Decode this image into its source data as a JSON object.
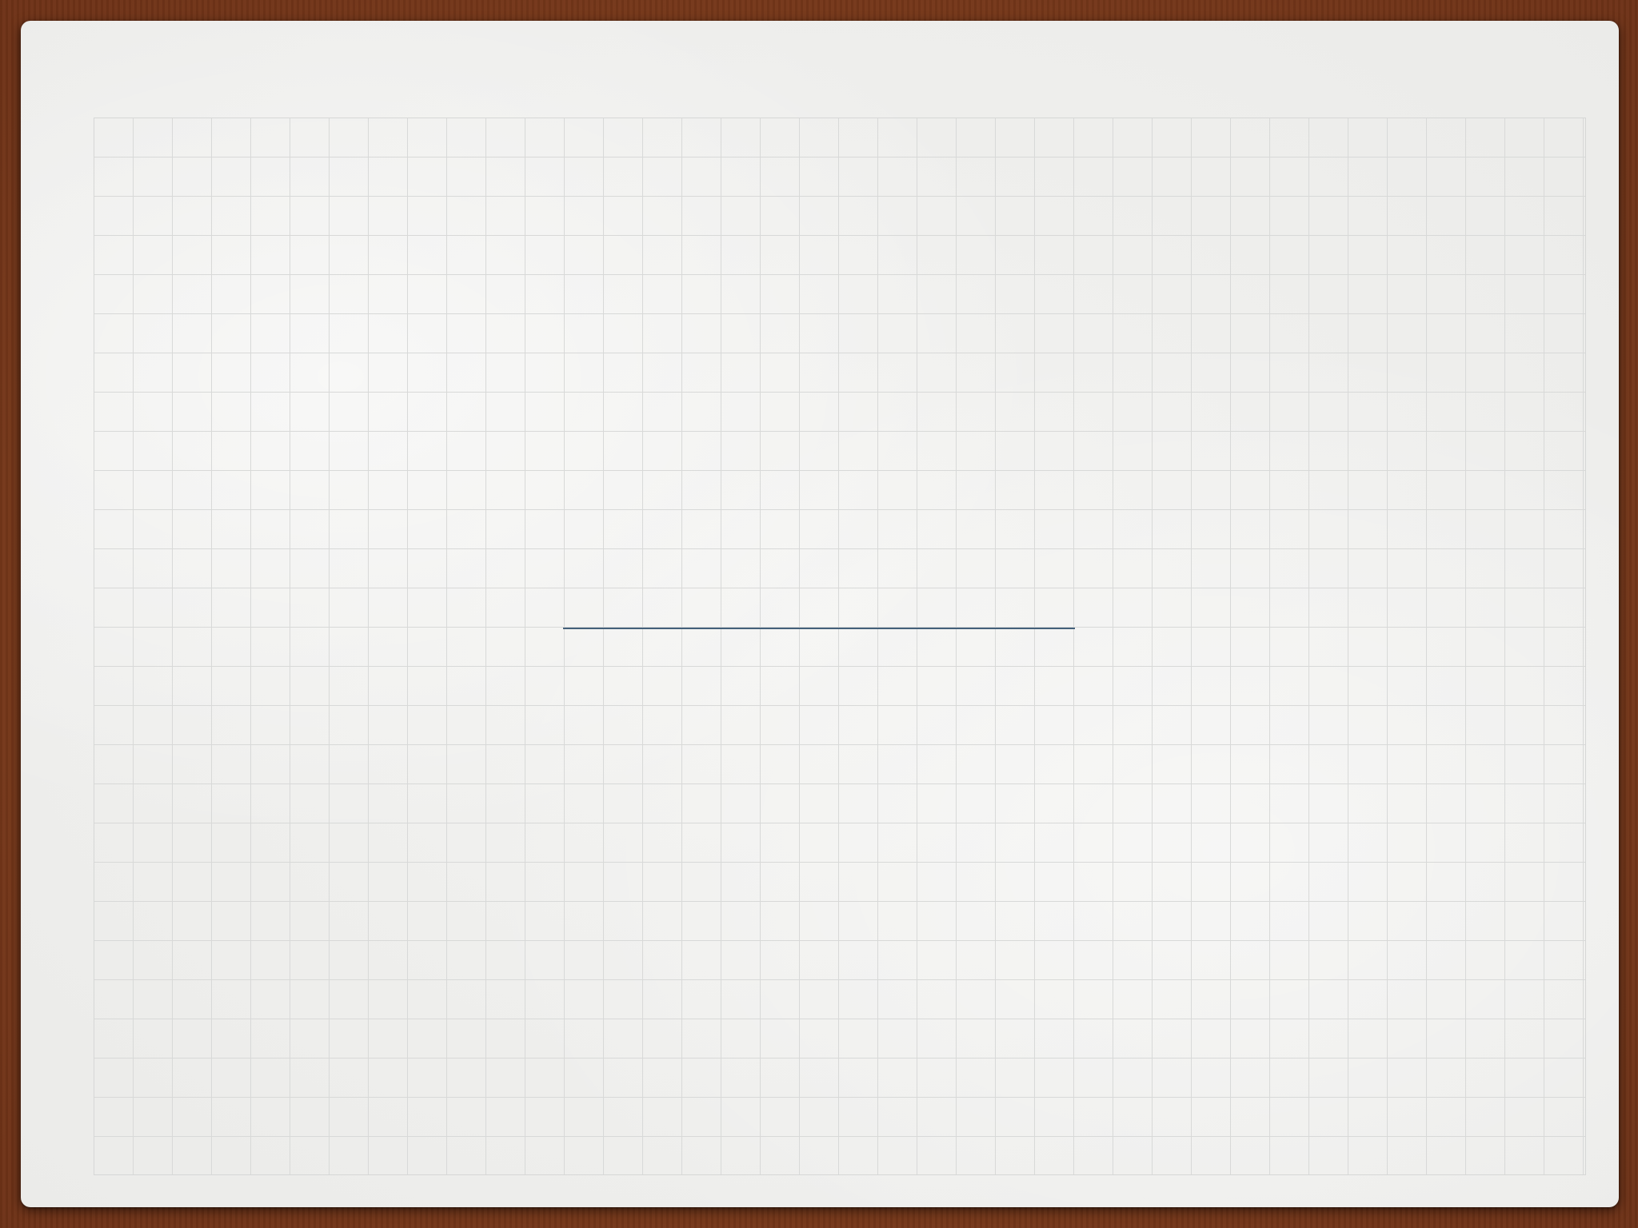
{
  "slide": {
    "title_placeholder": "",
    "accent_line_color": "#44607a"
  },
  "colors": {
    "desk": "#7a3a1c",
    "paper": "#efefed",
    "grid_line": "#d8d9d8"
  }
}
